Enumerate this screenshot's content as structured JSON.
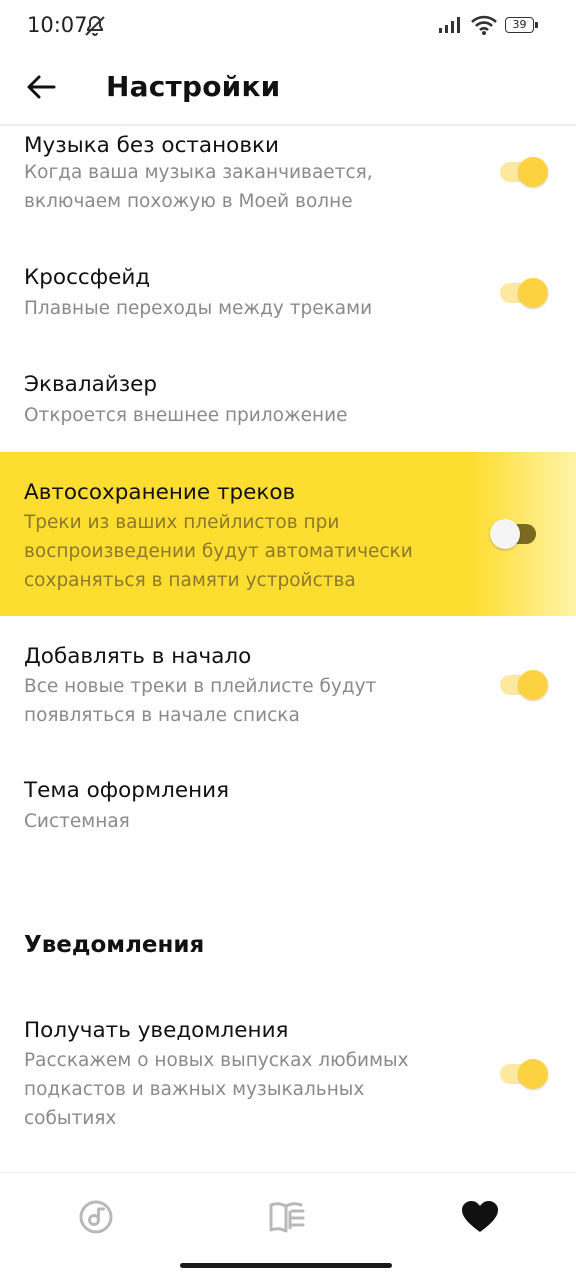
{
  "status_bar": {
    "time": "10:07",
    "battery": "39",
    "icons": [
      "mute-off-icon",
      "signal-icon",
      "wifi-icon",
      "battery-icon"
    ]
  },
  "header": {
    "title": "Настройки",
    "back_icon": "arrow-left-icon"
  },
  "settings": [
    {
      "title": "Музыка без остановки",
      "description": "Когда ваша музыка заканчивается, включаем похожую в Моей волне",
      "toggle": true
    },
    {
      "title": "Кроссфейд",
      "description": "Плавные переходы между треками",
      "toggle": true
    },
    {
      "title": "Эквалайзер",
      "description": "Откроется внешнее приложение"
    },
    {
      "title": "Автосохранение треков",
      "description": "Треки из ваших плейлистов при воспроизведении будут автоматически сохраняться в памяти устройства",
      "toggle": false,
      "highlighted": true
    },
    {
      "title": "Добавлять в начало",
      "description": "Все новые треки в плейлисте будут появляться в начале списка",
      "toggle": true
    },
    {
      "title": "Тема оформления",
      "description": "Системная"
    }
  ],
  "notifications_section": {
    "heading": "Уведомления",
    "items": [
      {
        "title": "Получать уведомления",
        "description": "Расскажем о новых выпусках любимых подкастов и важных музыкальных событиях",
        "toggle": true
      }
    ]
  },
  "bottom_nav": {
    "items": [
      {
        "icon": "music-disc-icon",
        "active": false
      },
      {
        "icon": "podcasts-book-icon",
        "active": false
      },
      {
        "icon": "heart-icon",
        "active": true
      }
    ]
  },
  "colors": {
    "accent_yellow": "#fedd31",
    "toggle_thumb_on": "#fdd240",
    "toggle_track_on": "#fde8a0",
    "secondary_text": "#8a8a8a"
  }
}
